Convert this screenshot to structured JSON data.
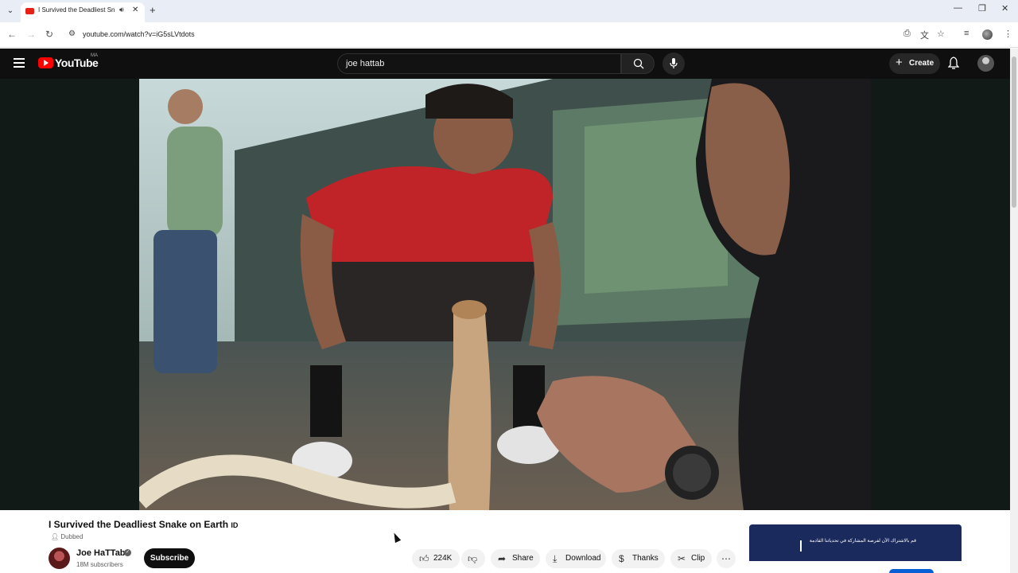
{
  "browser": {
    "tab": {
      "title": "I Survived the Deadliest Snake on Earth - YouTube"
    },
    "url": "youtube.com/watch?v=iG5sLVtdots"
  },
  "header": {
    "logo_text": "YouTube",
    "logo_country": "MA",
    "search_value": "joe hattab",
    "create_label": "Create"
  },
  "video": {
    "title": "I Survived the Deadliest Snake on Earth",
    "badge": "Dubbed",
    "channel_name": "Joe HaTTab",
    "subscribers": "18M subscribers",
    "subscribe_label": "Subscribe",
    "likes": "224K",
    "share_label": "Share",
    "download_label": "Download",
    "thanks_label": "Thanks",
    "clip_label": "Clip"
  },
  "ad": {
    "text": "قم بالاشتراك الآن لفرصة المشاركة في تحدياتنا القادمة"
  },
  "colors": {
    "yt_red": "#ff0000",
    "header_bg": "#0f0f0f",
    "subscribe_bg": "#0f0f0f"
  }
}
